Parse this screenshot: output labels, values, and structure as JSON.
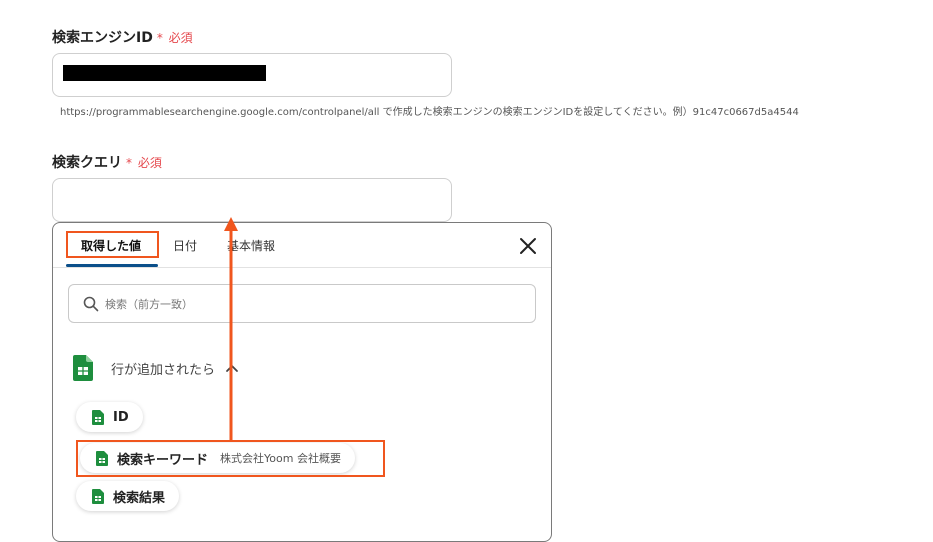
{
  "field1": {
    "label": "検索エンジンID",
    "required_star": "*",
    "required_text": "必須",
    "hint": "https://programmablesearchengine.google.com/controlpanel/all で作成した検索エンジンの検索エンジンIDを設定してください。例）91c47c0667d5a4544"
  },
  "field2": {
    "label": "検索クエリ",
    "required_star": "*",
    "required_text": "必須",
    "value": ""
  },
  "panel": {
    "tabs": [
      {
        "label": "取得した値"
      },
      {
        "label": "日付"
      },
      {
        "label": "基本情報"
      }
    ],
    "search_placeholder": "検索（前方一致）",
    "group": {
      "label": "行が追加されたら",
      "items": [
        {
          "label": "ID",
          "value": ""
        },
        {
          "label": "検索キーワード",
          "value": "株式会社Yoom 会社概要"
        },
        {
          "label": "検索結果",
          "value": ""
        }
      ]
    }
  },
  "colors": {
    "highlight": "#f0561e",
    "required": "#e5484d",
    "tab_underline": "#0b4f8a",
    "sheets_green": "#1e8e3e"
  },
  "icons": [
    "search-icon",
    "close-icon",
    "google-sheets-icon",
    "chevron-up-icon"
  ]
}
